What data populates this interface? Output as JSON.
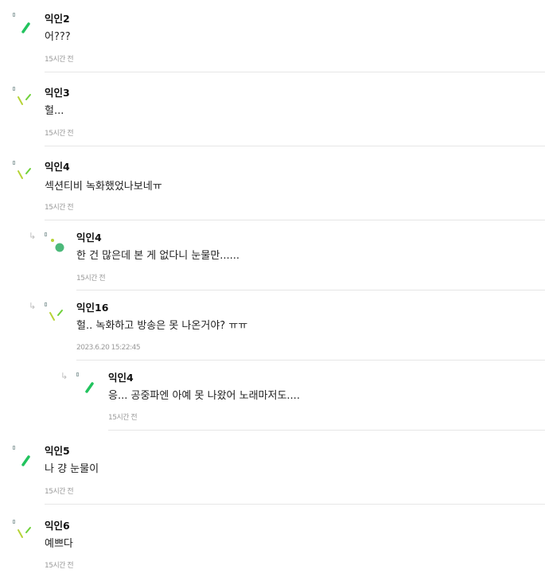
{
  "comments": [
    {
      "author": "익인2",
      "text": "어???",
      "time": "15시간 전"
    },
    {
      "author": "익인3",
      "text": "헐...",
      "time": "15시간 전"
    },
    {
      "author": "익인4",
      "text": "섹션티비 녹화했었나보네ㅠ",
      "time": "15시간 전"
    },
    {
      "author": "익인4",
      "text": "한 건 많은데 본 게 없다니 눈물만......",
      "time": "15시간 전"
    },
    {
      "author": "익인16",
      "text": "헐.. 녹화하고 방송은 못 나온거야? ㅠㅠ",
      "time": "2023.6.20 15:22:45"
    },
    {
      "author": "익인4",
      "text": "응... 공중파엔 아예 못 나왔어 노래마저도....",
      "time": "15시간 전"
    },
    {
      "author": "익인5",
      "text": "나 걍 눈물이",
      "time": "15시간 전"
    },
    {
      "author": "익인6",
      "text": "예쁘다",
      "time": "15시간 전"
    }
  ],
  "colors": {
    "avatar_green": "#22c35e",
    "avatar_yellow_green": "#b7d336",
    "avatar_lime": "#6fd13a",
    "avatar_mint": "#4cb97a",
    "divider": "#e6e6e6",
    "time_text": "#9a9a9a"
  },
  "icons": {
    "reply": "reply-arrow-icon",
    "avatar": "avatar-icon"
  }
}
